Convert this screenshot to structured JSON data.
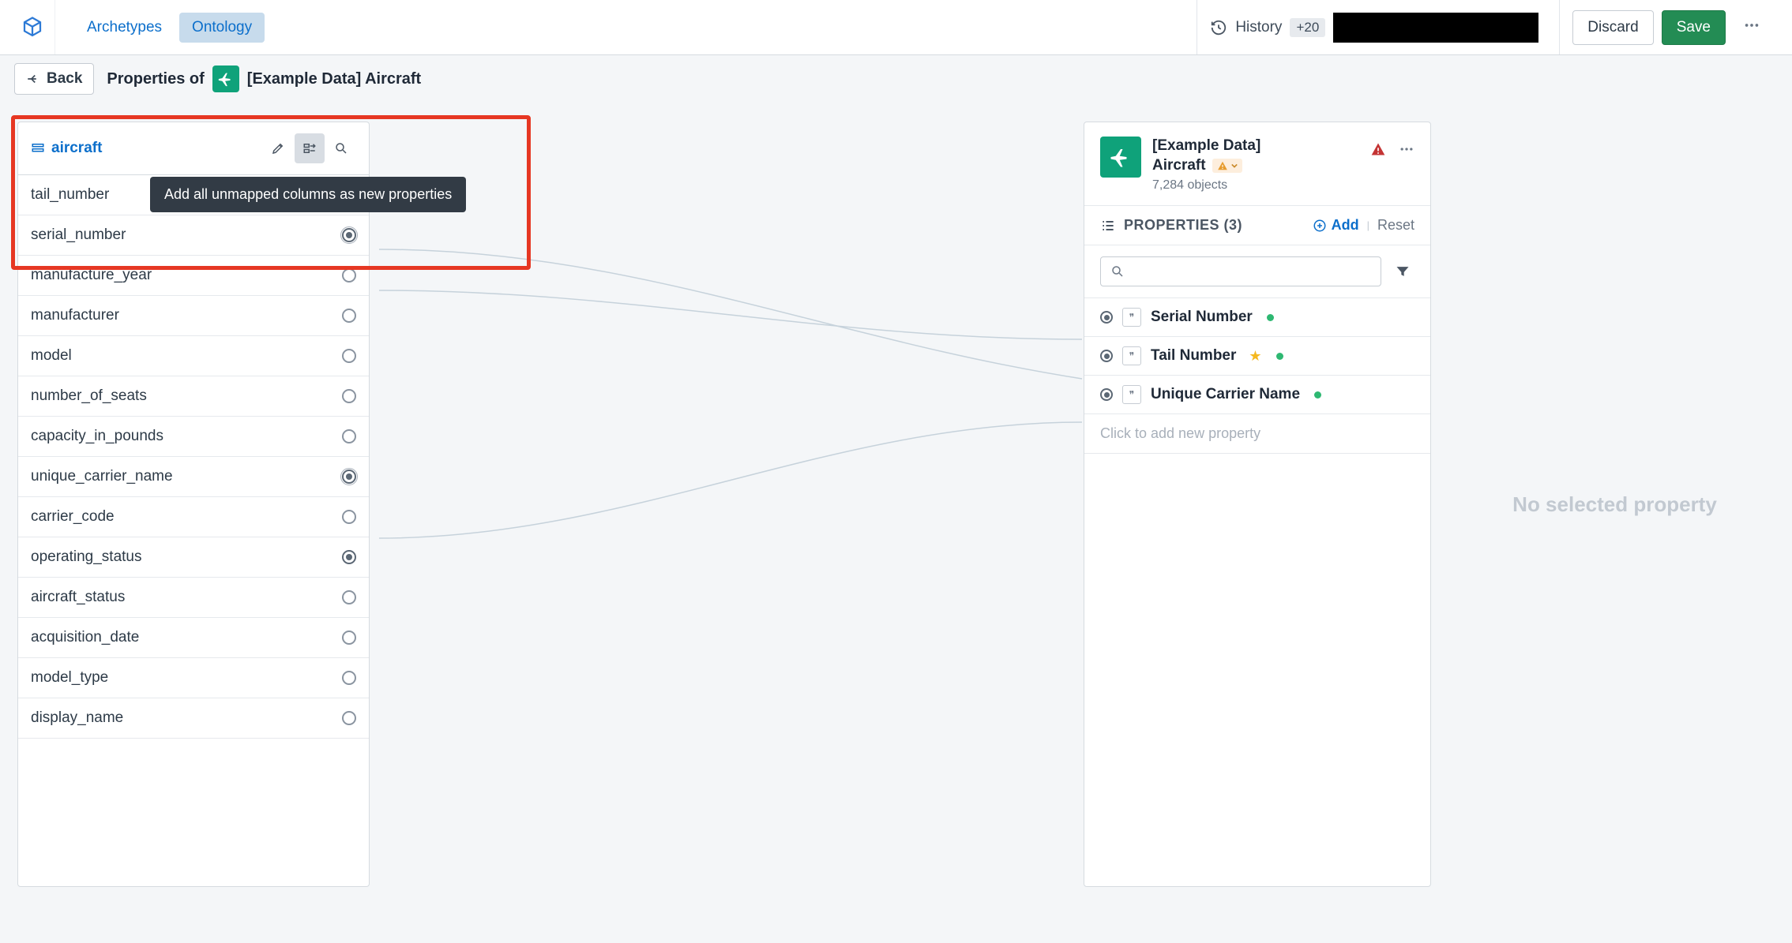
{
  "topbar": {
    "tabs": {
      "archetypes": "Archetypes",
      "ontology": "Ontology"
    },
    "history": "History",
    "history_badge": "+20",
    "discard": "Discard",
    "save": "Save"
  },
  "subbar": {
    "back": "Back",
    "properties_of": "Properties of",
    "entity": "[Example Data] Aircraft"
  },
  "left_panel": {
    "source": "aircraft",
    "tooltip": "Add all unmapped columns as new properties",
    "columns": [
      {
        "name": "tail_number",
        "state": "mapped-outer"
      },
      {
        "name": "serial_number",
        "state": "mapped-outer"
      },
      {
        "name": "manufacture_year",
        "state": "unmapped"
      },
      {
        "name": "manufacturer",
        "state": "unmapped"
      },
      {
        "name": "model",
        "state": "unmapped"
      },
      {
        "name": "number_of_seats",
        "state": "unmapped"
      },
      {
        "name": "capacity_in_pounds",
        "state": "unmapped"
      },
      {
        "name": "unique_carrier_name",
        "state": "mapped-outer"
      },
      {
        "name": "carrier_code",
        "state": "unmapped"
      },
      {
        "name": "operating_status",
        "state": "mapped"
      },
      {
        "name": "aircraft_status",
        "state": "unmapped"
      },
      {
        "name": "acquisition_date",
        "state": "unmapped"
      },
      {
        "name": "model_type",
        "state": "unmapped"
      },
      {
        "name": "display_name",
        "state": "unmapped"
      }
    ]
  },
  "right_panel": {
    "title_line1": "[Example Data]",
    "title_line2": "Aircraft",
    "object_count": "7,284 objects",
    "section_title": "PROPERTIES (3)",
    "add": "Add",
    "reset": "Reset",
    "placeholder": "Click to add new property",
    "properties": [
      {
        "name": "Serial Number",
        "starred": false
      },
      {
        "name": "Tail Number",
        "starred": true
      },
      {
        "name": "Unique Carrier Name",
        "starred": false
      }
    ]
  },
  "empty": "No selected property"
}
